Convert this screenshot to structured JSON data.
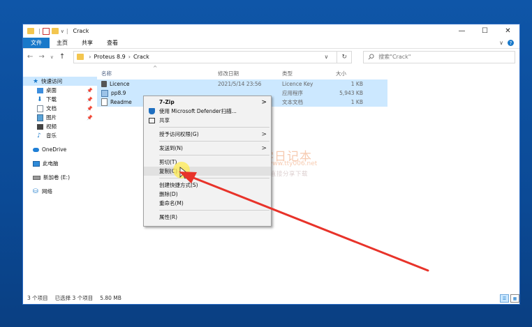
{
  "window": {
    "title": "Crack",
    "min": "—",
    "max": "☐",
    "close": "✕"
  },
  "ribbon": {
    "tabs": [
      "文件",
      "主页",
      "共享",
      "查看"
    ],
    "expand": "∨",
    "help": "?"
  },
  "nav": {
    "back": "←",
    "forward": "→",
    "recent": "∨",
    "up": "↑",
    "path": [
      "Proteus 8.9",
      "Crack"
    ],
    "sep": "›",
    "dropdown": "∨",
    "refresh": "↻",
    "search_placeholder": "搜索\"Crack\""
  },
  "navpane": [
    {
      "label": "快速访问",
      "icon": "star-icon"
    },
    {
      "label": "桌面",
      "icon": "desktop-icon",
      "pinned": true
    },
    {
      "label": "下载",
      "icon": "download-icon",
      "pinned": true
    },
    {
      "label": "文档",
      "icon": "document-icon",
      "pinned": true
    },
    {
      "label": "图片",
      "icon": "picture-icon",
      "pinned": true
    },
    {
      "label": "视频",
      "icon": "video-icon"
    },
    {
      "label": "音乐",
      "icon": "music-icon"
    },
    {
      "label": "OneDrive",
      "icon": "cloud-icon"
    },
    {
      "label": "此电脑",
      "icon": "computer-icon"
    },
    {
      "label": "新加卷 (E:)",
      "icon": "drive-icon"
    },
    {
      "label": "网络",
      "icon": "network-icon"
    }
  ],
  "columns": {
    "name": "名称",
    "date": "修改日期",
    "type": "类型",
    "size": "大小",
    "sort": "^"
  },
  "files": [
    {
      "name": "Licence",
      "date": "2021/5/14 23:56",
      "type": "Licence Key",
      "size": "1 KB",
      "icon": "key-file-icon"
    },
    {
      "name": "pp8.9",
      "date": "",
      "type": "应用程序",
      "size": "5,943 KB",
      "icon": "application-icon"
    },
    {
      "name": "Readme",
      "date": "",
      "type": "文本文档",
      "size": "1 KB",
      "icon": "text-file-icon"
    }
  ],
  "status": {
    "count": "3 个项目",
    "selected": "已选择 3 个项目",
    "size": "5.80 MB"
  },
  "context_menu": {
    "zip": "7-Zip",
    "defender": "使用 Microsoft Defender扫描...",
    "share": "共享",
    "access": "授予访问权限(G)",
    "sendto": "发送到(N)",
    "cut": "剪切(T)",
    "copy": "复制(C)",
    "shortcut": "创建快捷方式(S)",
    "delete": "删除(D)",
    "rename": "重命名(M)",
    "properties": "属性(R)",
    "submenu_arrow": ">"
  },
  "watermark": {
    "title": "丁同学日记本",
    "url": "www.tty006.net",
    "sub": "软件、资源、资料网盘直接分享下载"
  },
  "colors": {
    "accent": "#1979ca",
    "selection": "#cce8ff",
    "arrow": "#e8332a"
  }
}
